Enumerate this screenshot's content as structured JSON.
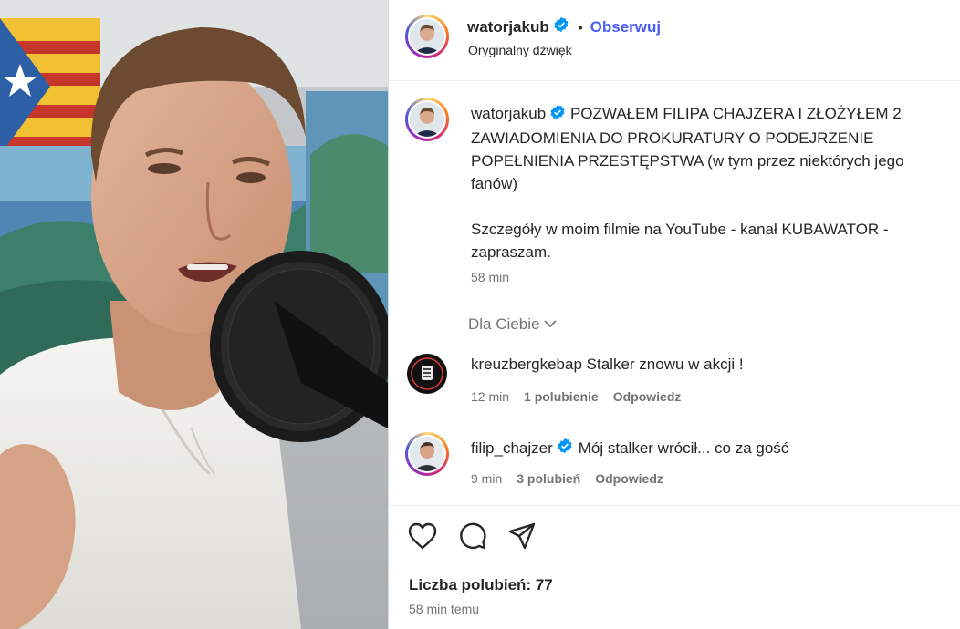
{
  "post": {
    "author": "watorjakub",
    "follow_label": "Obserwuj",
    "separator": "•",
    "audio": "Oryginalny dźwięk",
    "caption_user": "watorjakub",
    "caption": "POZWAŁEM FILIPA CHAJZERA I ZŁOŻYŁEM 2 ZAWIADOMIENIA DO PROKURATURY O PODEJRZENIE POPEŁNIENIA PRZESTĘPSTWA (w tym przez niektórych jego fanów)\n\nSzczegóły w moim filmie na YouTube - kanał KUBAWATOR - zapraszam.",
    "caption_time": "58 min"
  },
  "comments_filter": "Dla Ciebie",
  "comments": [
    {
      "user": "kreuzbergkebap",
      "text": "Stalker znowu w akcji !",
      "time": "12 min",
      "likes": "1 polubienie",
      "reply": "Odpowiedz",
      "verified": false
    },
    {
      "user": "filip_chajzer",
      "text": "Mój stalker wrócił... co za gość",
      "time": "9 min",
      "likes": "3 polubień",
      "reply": "Odpowiedz",
      "verified": true
    }
  ],
  "actions": [
    "heart-icon",
    "comment-icon",
    "share-icon"
  ],
  "likes_summary": "Liczba polubień: 77",
  "posted_ago": "58 min temu",
  "colors": {
    "accent": "#4a5df9",
    "verified": "#0095f6",
    "muted": "#737373",
    "text": "#262626"
  }
}
